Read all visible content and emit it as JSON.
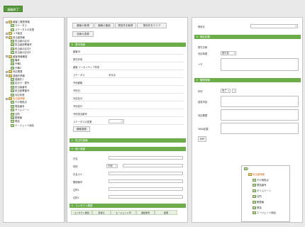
{
  "top_button": "編集終了",
  "tree": [
    {
      "label": "顧客と履歴情報",
      "kind": "folder",
      "exp": true,
      "indent": 0,
      "orange": false
    },
    {
      "label": "ステータス",
      "kind": "leaf",
      "exp": false,
      "indent": 1,
      "orange": false
    },
    {
      "label": "ステータスの変更",
      "kind": "leaf",
      "exp": false,
      "indent": 1,
      "orange": false
    },
    {
      "label": "ハネ転送",
      "kind": "folder",
      "exp": true,
      "indent": 0,
      "orange": false
    },
    {
      "label": "担当者情報",
      "kind": "folder",
      "exp": true,
      "indent": 0,
      "orange": false
    },
    {
      "label": "担当者の区切",
      "kind": "leaf",
      "exp": false,
      "indent": 1,
      "orange": false
    },
    {
      "label": "担当者部署番号",
      "kind": "leaf",
      "exp": false,
      "indent": 1,
      "orange": false
    },
    {
      "label": "担当者の区切1",
      "kind": "leaf",
      "exp": false,
      "indent": 1,
      "orange": false
    },
    {
      "label": "担当者の区切2",
      "kind": "leaf",
      "exp": false,
      "indent": 1,
      "orange": false
    },
    {
      "label": "顧客情報確認",
      "kind": "folder",
      "exp": true,
      "indent": 0,
      "orange": false
    },
    {
      "label": "備考",
      "kind": "leaf",
      "exp": false,
      "indent": 1,
      "orange": false
    },
    {
      "label": "予備1",
      "kind": "leaf",
      "exp": false,
      "indent": 1,
      "orange": false
    },
    {
      "label": "予備2",
      "kind": "leaf",
      "exp": false,
      "indent": 1,
      "orange": false
    },
    {
      "label": "対応履歴",
      "kind": "folder",
      "exp": true,
      "indent": 0,
      "orange": false
    },
    {
      "label": "連絡先情報",
      "kind": "folder",
      "exp": true,
      "indent": 0,
      "orange": false
    },
    {
      "label": "連絡先1",
      "kind": "leaf",
      "exp": false,
      "indent": 1,
      "orange": false
    },
    {
      "label": "区分け・優先",
      "kind": "leaf",
      "exp": false,
      "indent": 1,
      "orange": false
    },
    {
      "label": "担当者番号",
      "kind": "leaf",
      "exp": false,
      "indent": 1,
      "orange": false
    },
    {
      "label": "担当部署番号",
      "kind": "leaf",
      "exp": false,
      "indent": 1,
      "orange": false
    },
    {
      "label": "対応状態",
      "kind": "leaf",
      "exp": false,
      "indent": 1,
      "orange": false
    },
    {
      "label": "担当者情報",
      "kind": "folder",
      "exp": true,
      "indent": 0,
      "orange": true
    },
    {
      "label": "その他拠点",
      "kind": "leaf",
      "exp": false,
      "indent": 1,
      "orange": false
    },
    {
      "label": "電話番号",
      "kind": "leaf",
      "exp": false,
      "indent": 1,
      "orange": false
    },
    {
      "label": "タイムゾーン",
      "kind": "leaf",
      "exp": false,
      "indent": 1,
      "orange": false
    },
    {
      "label": "住所",
      "kind": "leaf",
      "exp": false,
      "indent": 1,
      "orange": false
    },
    {
      "label": "郵便番",
      "kind": "leaf",
      "exp": false,
      "indent": 1,
      "orange": false
    },
    {
      "label": "電話",
      "kind": "leaf",
      "exp": false,
      "indent": 1,
      "orange": false
    },
    {
      "label": "エージェント面会",
      "kind": "leaf",
      "exp": false,
      "indent": 1,
      "orange": false
    }
  ],
  "toolbar": [
    "顧客の新規",
    "顧客の複製",
    "受信先を取得",
    "受信先をクリア",
    "技術の変更"
  ],
  "sections": {
    "basic": "基本情報",
    "branch": "担当先情報",
    "person": "個人情報",
    "contact": "コンタクト履歴",
    "other": "補足記載",
    "account": "履歴情報"
  },
  "basic_fields": [
    {
      "label": "顧客ID",
      "value": ""
    },
    {
      "label": "受付作成",
      "value": ""
    },
    {
      "label": "顧客 インセンティブ作成",
      "value": ""
    },
    {
      "label": "ステータス",
      "value": "未対応"
    },
    {
      "label": "予約顧客",
      "value": ""
    },
    {
      "label": "予約日",
      "value": ""
    },
    {
      "label": "対応区分",
      "value": ""
    },
    {
      "label": "予約窓口",
      "value": ""
    },
    {
      "label": "予約担当番号",
      "value": ""
    },
    {
      "label": "ステータスの変更",
      "value": ""
    }
  ],
  "change_button": "顧客登録",
  "person_fields": [
    "氏名",
    "性別",
    "氏名カナ",
    "郵便番号",
    "住所1",
    "住所2"
  ],
  "gender_select": "不明",
  "contact_cols": [
    "コンタクト種別",
    "受信元",
    "エージェントID",
    "通話番号",
    "結果"
  ],
  "right": {
    "field1_label": "受信元",
    "other_fields": [
      {
        "label": "受付日時",
        "value": ""
      },
      {
        "label": "対応時間",
        "value": "受付前"
      },
      {
        "label": "メモ",
        "value": ""
      }
    ],
    "account_fields": [
      "状況",
      "回答内容",
      "対応履歴",
      "ToDo記載"
    ],
    "status_select": "完了",
    "edit_button": "ESP"
  },
  "popup_tree": [
    {
      "label": "!",
      "kind": "root",
      "indent": 0,
      "orange": false
    },
    {
      "label": "担当者情報",
      "kind": "folder",
      "indent": 1,
      "orange": true
    },
    {
      "label": "その他拠点",
      "kind": "leaf",
      "indent": 2,
      "orange": false
    },
    {
      "label": "電話番号",
      "kind": "leaf",
      "indent": 2,
      "orange": false
    },
    {
      "label": "タイムゾーン",
      "kind": "leaf",
      "indent": 2,
      "orange": false
    },
    {
      "label": "住所",
      "kind": "leaf",
      "indent": 2,
      "orange": false
    },
    {
      "label": "郵便番",
      "kind": "leaf",
      "indent": 2,
      "orange": false
    },
    {
      "label": "電話",
      "kind": "leaf",
      "indent": 2,
      "orange": false
    },
    {
      "label": "エージェント面会",
      "kind": "leaf",
      "indent": 2,
      "orange": false
    }
  ]
}
